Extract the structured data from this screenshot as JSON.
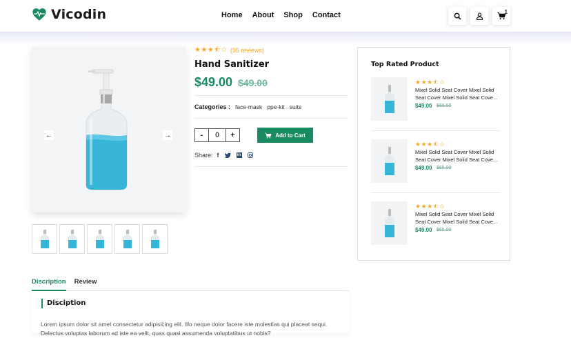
{
  "brand": {
    "name": "Vicodin",
    "accent": "#1a8a61"
  },
  "nav": {
    "items": [
      "Home",
      "About",
      "Shop",
      "Contact"
    ]
  },
  "header_icons": {
    "search": "search-icon",
    "user": "user-icon",
    "cart": "cart-icon",
    "cart_count": "1"
  },
  "gallery": {
    "prev_icon": "arrow-left-icon",
    "next_icon": "arrow-right-icon",
    "thumb_count": 5
  },
  "product": {
    "rating": 3.5,
    "reviews": "(95 reviews)",
    "name": "Hand Sanitizer",
    "price": "$49.00",
    "old_price": "$49.00",
    "categories_label": "Categories :",
    "categories": [
      "face-mask",
      "ppe-kit",
      "suits"
    ],
    "qty_minus": "-",
    "qty_value": "0",
    "qty_plus": "+",
    "add_to_cart": "Add to Cart",
    "share_label": "Share:"
  },
  "sidebar": {
    "title": "Top Rated Product",
    "items": [
      {
        "rating": 3.5,
        "name": "Mixel Solid Seat Cover Mixel Solid Seat Cover Mixel Solid Seat Cove...",
        "price": "$49.00",
        "old_price": "$65.00"
      },
      {
        "rating": 3.5,
        "name": "Mixel Solid Seat Cover Mixel Solid Seat Cover Mixel Solid Seat Cove...",
        "price": "$49.00",
        "old_price": "$65.00"
      },
      {
        "rating": 3.5,
        "name": "Mixel Solid Seat Cover Mixel Solid Seat Cover Mixel Solid Seat Cove...",
        "price": "$49.00",
        "old_price": "$65.00"
      }
    ]
  },
  "tabs": [
    "Discription",
    "Review"
  ],
  "description": {
    "title": "Disciption",
    "text": "Lorem ipsum dolor sit amet consectetur adipisicing elit. Illo neque dolor facere iste molestias qui placeat sequi. Delectus voluptas laborum ad iste ea velit, quas quasi assumenda voluptatibus ut nobis?"
  }
}
